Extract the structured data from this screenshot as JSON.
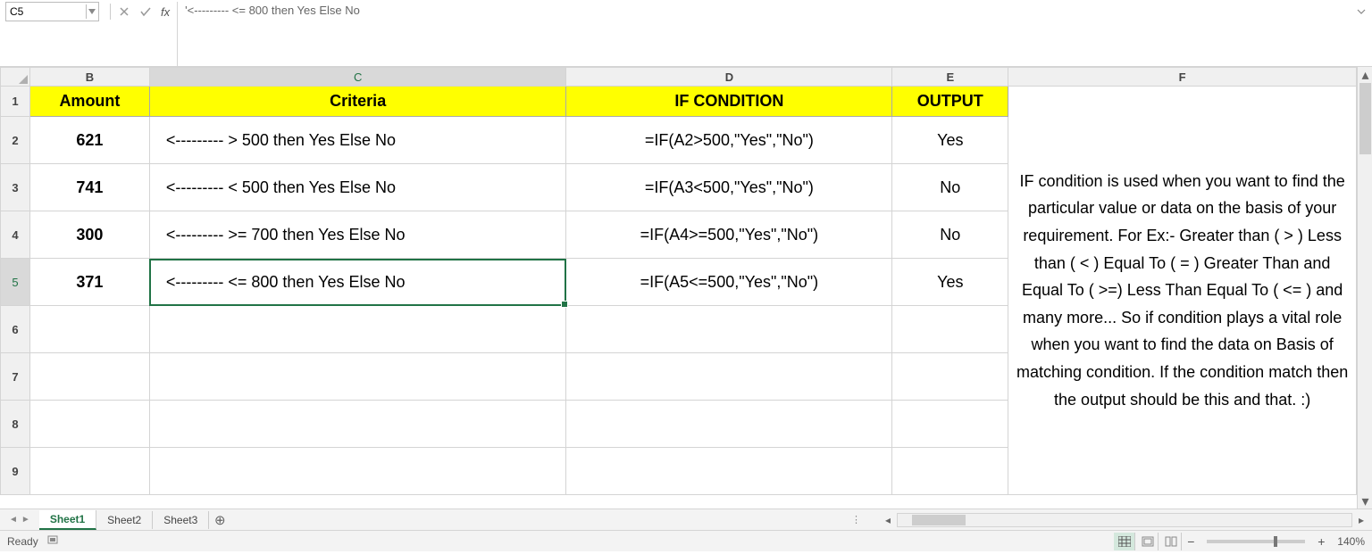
{
  "formula_bar": {
    "cell_ref": "C5",
    "formula": "'<---------     <= 800 then Yes Else No"
  },
  "columns": [
    "B",
    "C",
    "D",
    "E",
    "F"
  ],
  "col_widths": {
    "rowhdr": 33,
    "B": 134,
    "C": 467,
    "D": 365,
    "E": 130,
    "F": 390
  },
  "headers": {
    "amount": "Amount",
    "criteria": "Criteria",
    "if_cond": "IF CONDITION",
    "output": "OUTPUT"
  },
  "rows": [
    {
      "n": 2,
      "amount": "621",
      "criteria": "<---------     > 500 then Yes Else No",
      "formula": "=IF(A2>500,\"Yes\",\"No\")",
      "output": "Yes"
    },
    {
      "n": 3,
      "amount": "741",
      "criteria": "<---------     < 500 then Yes Else No",
      "formula": "=IF(A3<500,\"Yes\",\"No\")",
      "output": "No"
    },
    {
      "n": 4,
      "amount": "300",
      "criteria": "<---------     >= 700 then Yes Else No",
      "formula": "=IF(A4>=500,\"Yes\",\"No\")",
      "output": "No"
    },
    {
      "n": 5,
      "amount": "371",
      "criteria": "<---------     <= 800 then Yes Else No",
      "formula": "=IF(A5<=500,\"Yes\",\"No\")",
      "output": "Yes"
    }
  ],
  "empty_rows": [
    6,
    7,
    8,
    9
  ],
  "notes": "IF condition is used when you want to find the particular value or data on the basis of your requirement. For Ex:- Greater than ( > ) Less than ( < ) Equal To ( = ) Greater Than and Equal To ( >=) Less Than Equal To ( <= ) and many more... So if condition plays a vital role when you want to find the data on Basis of matching condition. If the condition match then the output should be this and that. :)",
  "sheets": [
    "Sheet1",
    "Sheet2",
    "Sheet3"
  ],
  "active_sheet": 0,
  "selected_cell": {
    "row": 5,
    "col": "C"
  },
  "status": {
    "ready": "Ready",
    "zoom": "140%"
  }
}
